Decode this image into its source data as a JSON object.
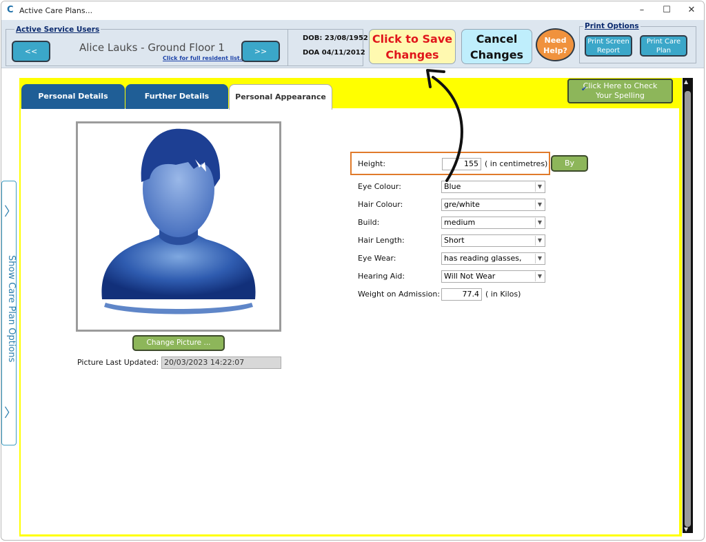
{
  "window": {
    "title": "Active Care Plans...",
    "logo": "C",
    "minimize_icon": "–",
    "maximize_icon": "☐",
    "close_icon": "✕"
  },
  "service_users": {
    "group_title": "Active Service Users",
    "prev_label": "<<",
    "next_label": ">>",
    "resident_name": "Alice Lauks - Ground Floor 1",
    "full_list_link": "Click for full resident list...",
    "dob": "DOB: 23/08/1952",
    "doa": "DOA 04/11/2012"
  },
  "actions": {
    "save_line1": "Click to Save",
    "save_line2": "Changes",
    "cancel_line1": "Cancel",
    "cancel_line2": "Changes",
    "help_line1": "Need",
    "help_line2": "Help?"
  },
  "print_options": {
    "group_title": "Print Options",
    "screen_report_line1": "Print Screen",
    "screen_report_line2": "Report",
    "care_plan_line1": "Print Care",
    "care_plan_line2": "Plan"
  },
  "side_panel": {
    "label": "Show Care Plan Options",
    "chevron": "〉"
  },
  "tabs": [
    {
      "label": "Personal Details"
    },
    {
      "label": "Further Details"
    },
    {
      "label": "Personal Appearance"
    }
  ],
  "spelling": {
    "icon": "spellcheck-icon",
    "line1": "Click Here to Check",
    "line2": "Your Spelling"
  },
  "picture": {
    "change_label": "Change Picture ...",
    "last_updated_label": "Picture Last Updated:",
    "last_updated_value": "20/03/2023 14:22:07"
  },
  "appearance": {
    "height_label": "Height:",
    "height_value": "155",
    "height_unit": "( in centimetres)",
    "ulna_label": "By Ulna...",
    "eye_colour_label": "Eye Colour:",
    "eye_colour_value": "Blue",
    "hair_colour_label": "Hair Colour:",
    "hair_colour_value": "gre/white",
    "build_label": "Build:",
    "build_value": "medium",
    "hair_length_label": "Hair Length:",
    "hair_length_value": "Short",
    "eye_wear_label": "Eye Wear:",
    "eye_wear_value": "has reading glasses,",
    "hearing_aid_label": "Hearing Aid:",
    "hearing_aid_value": "Will Not Wear",
    "weight_label": "Weight on Admission:",
    "weight_value": "77.4",
    "weight_unit": "( in Kilos)"
  },
  "colors": {
    "accent_yellow": "#ffff00",
    "nav_button": "#3ba7c9",
    "green_button": "#8db65a",
    "save_bg": "#fff9b0",
    "save_text": "#e0161b",
    "highlight_border": "#e07a2a",
    "tab_dark": "#1f5e96"
  }
}
